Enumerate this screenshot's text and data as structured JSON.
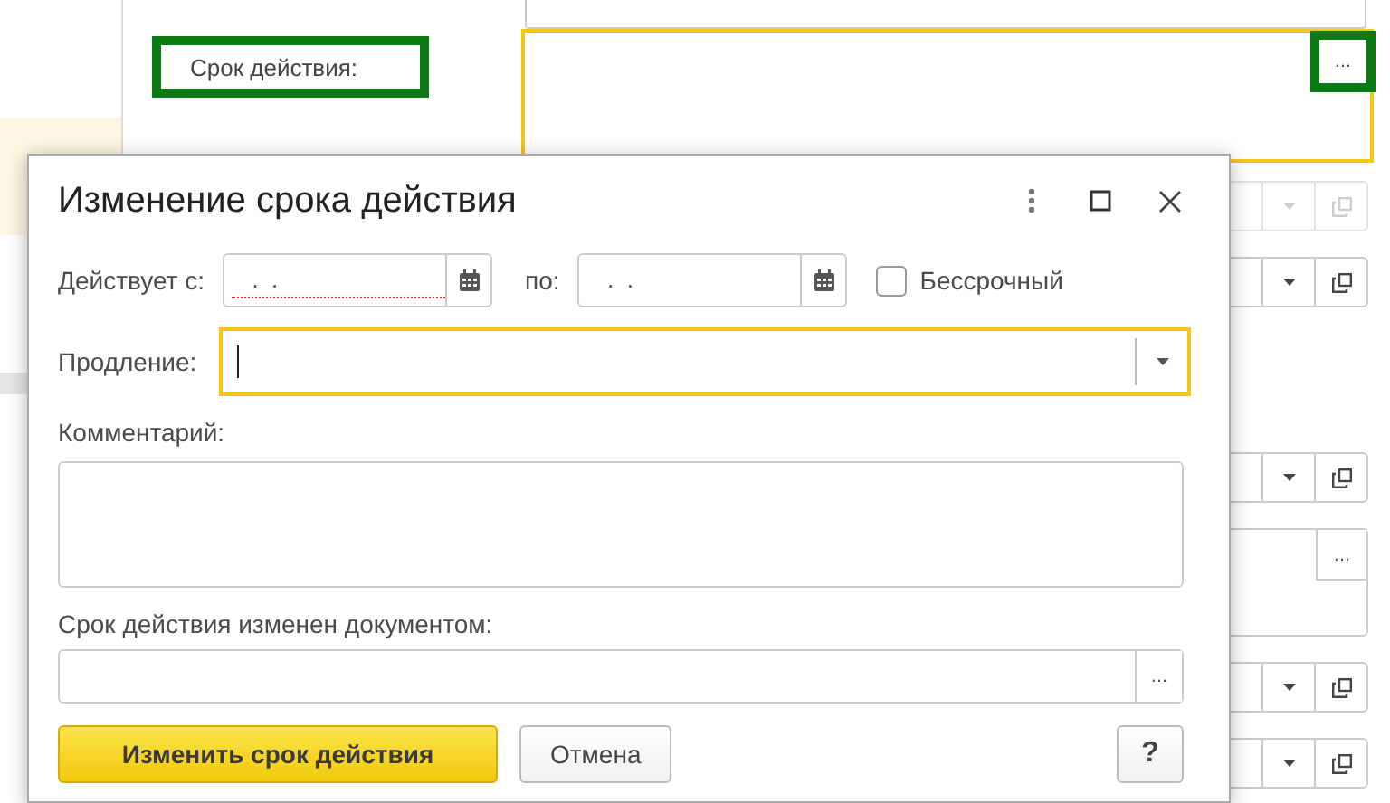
{
  "background": {
    "deadline_label": "Срок действия:",
    "deadline_field": {
      "focused": true,
      "button": "..."
    },
    "side_fields": [
      {
        "kind": "dropdown",
        "disabled": true
      },
      {
        "kind": "dropdown",
        "disabled": false
      },
      {
        "kind": "dropdown",
        "disabled": false
      },
      {
        "kind": "textarea",
        "button": "..."
      },
      {
        "kind": "dropdown",
        "disabled": false
      },
      {
        "kind": "dropdown",
        "disabled": false
      }
    ]
  },
  "dialog": {
    "title": "Изменение срока действия",
    "date_from": {
      "label": "Действует с:",
      "value": "  .  .",
      "required": true
    },
    "date_to": {
      "label": "по:",
      "value": "  .  .",
      "required": false
    },
    "unlimited": {
      "label": "Бессрочный",
      "checked": false
    },
    "extension": {
      "label": "Продление:",
      "focused": true
    },
    "comment": {
      "label": "Комментарий:"
    },
    "document": {
      "label": "Срок действия изменен документом:",
      "button": "..."
    },
    "buttons": [
      {
        "label": "Изменить срок действия",
        "kind": "primary"
      },
      {
        "label": "Отмена",
        "kind": "default"
      },
      {
        "label": "?",
        "kind": "help"
      }
    ]
  }
}
